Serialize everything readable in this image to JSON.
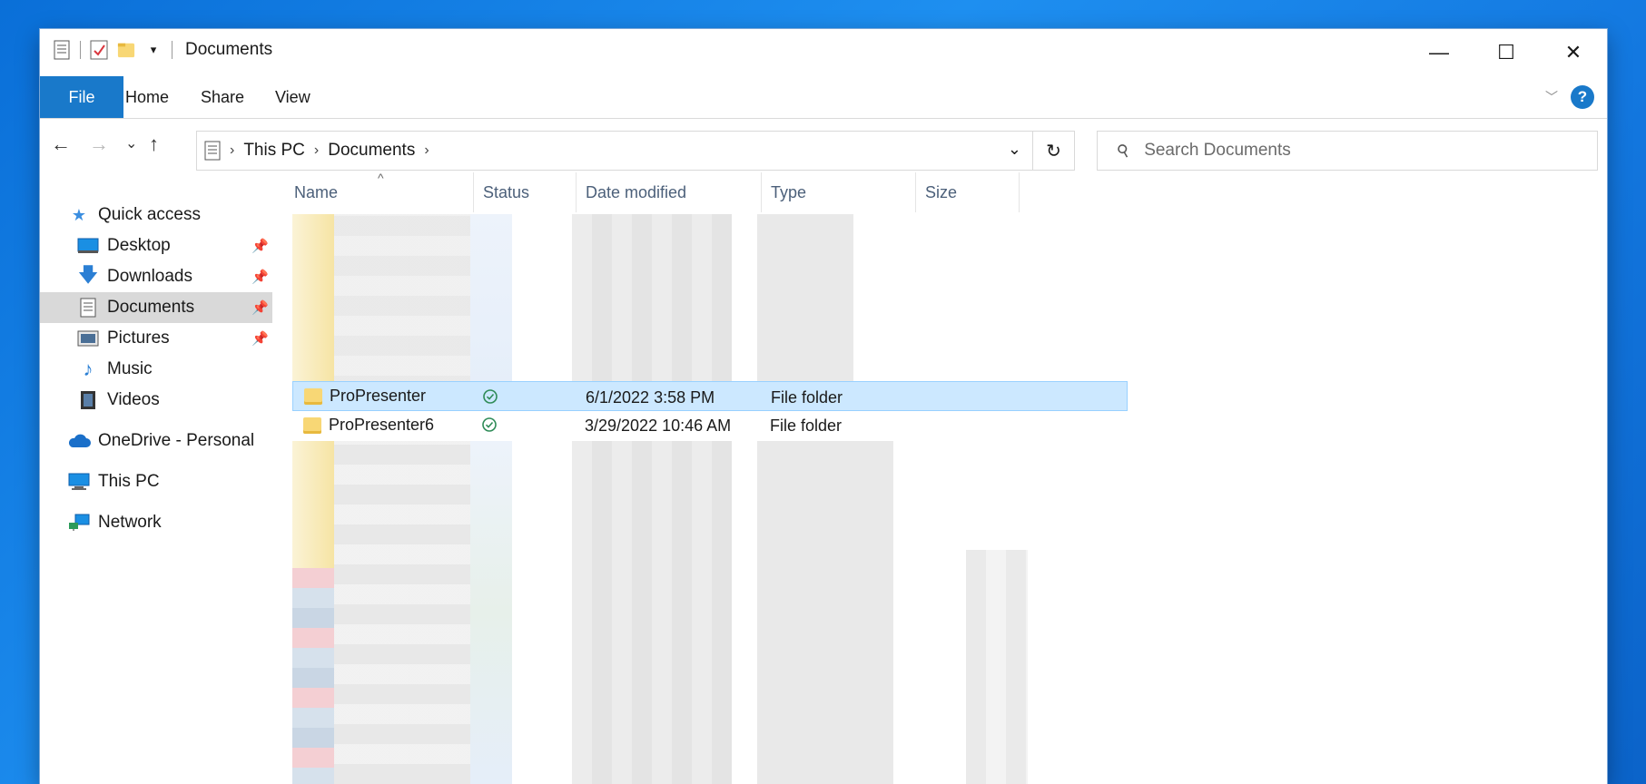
{
  "window": {
    "title": "Documents",
    "controls": {
      "minimize": "—",
      "maximize": "☐",
      "close": "✕"
    }
  },
  "ribbon": {
    "tabs": [
      "File",
      "Home",
      "Share",
      "View"
    ],
    "help": "?"
  },
  "navbar": {
    "back": "←",
    "forward": "→",
    "recent": "⌄",
    "up": "↑",
    "breadcrumb": [
      "This PC",
      "Documents"
    ],
    "refresh": "↻",
    "search_placeholder": "Search Documents"
  },
  "navpane": {
    "items": [
      {
        "label": "Quick access",
        "icon": "star-icon",
        "pinned": false,
        "selected": false
      },
      {
        "label": "Desktop",
        "icon": "desktop-icon",
        "pinned": true,
        "selected": false
      },
      {
        "label": "Downloads",
        "icon": "download-icon",
        "pinned": true,
        "selected": false
      },
      {
        "label": "Documents",
        "icon": "documents-icon",
        "pinned": true,
        "selected": true
      },
      {
        "label": "Pictures",
        "icon": "pictures-icon",
        "pinned": true,
        "selected": false
      },
      {
        "label": "Music",
        "icon": "music-icon",
        "pinned": false,
        "selected": false
      },
      {
        "label": "Videos",
        "icon": "videos-icon",
        "pinned": false,
        "selected": false
      },
      {
        "label": "OneDrive - Personal",
        "icon": "cloud-icon",
        "pinned": false,
        "selected": false
      },
      {
        "label": "This PC",
        "icon": "computer-icon",
        "pinned": false,
        "selected": false
      },
      {
        "label": "Network",
        "icon": "network-icon",
        "pinned": false,
        "selected": false
      }
    ]
  },
  "filelist": {
    "columns": [
      "Name",
      "Status",
      "Date modified",
      "Type",
      "Size"
    ],
    "rows": [
      {
        "name": "ProPresenter",
        "status": "synced",
        "date": "6/1/2022 3:58 PM",
        "type": "File folder",
        "size": "",
        "selected": true
      },
      {
        "name": "ProPresenter6",
        "status": "synced",
        "date": "3/29/2022 10:46 AM",
        "type": "File folder",
        "size": "",
        "selected": false
      }
    ]
  },
  "colors": {
    "accent": "#1979ca",
    "selection": "#cce8ff",
    "folder": "#f8d775",
    "status_ok": "#2e8b57"
  }
}
